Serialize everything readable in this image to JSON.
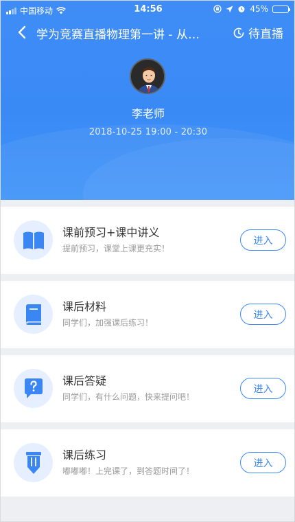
{
  "status_bar": {
    "carrier": "中国移动",
    "time": "14:56",
    "battery": "45%",
    "battery_level": 0.45
  },
  "nav": {
    "title": "学为竞赛直播物理第一讲 - 从…",
    "status_label": "待直播"
  },
  "teacher": {
    "name": "李老师",
    "schedule": "2018-10-25  19:00 - 20:30"
  },
  "colors": {
    "primary": "#3a87f4",
    "header_bg": "#3f8cf6",
    "icon_bg": "#e5efff"
  },
  "sections": [
    {
      "title": "课前预习+课中讲义",
      "subtitle": "提前预习，课堂上课更充实！",
      "button": "进入",
      "icon": "open-book-icon"
    },
    {
      "title": "课后材料",
      "subtitle": "同学们，加强课后练习！",
      "button": "进入",
      "icon": "book-icon"
    },
    {
      "title": "课后答疑",
      "subtitle": "同学们，有什么问题，快来提问吧！",
      "button": "进入",
      "icon": "question-bubble-icon"
    },
    {
      "title": "课后练习",
      "subtitle": "嘟嘟嘟！上完课了，到答题时间了！",
      "button": "进入",
      "icon": "pen-icon"
    }
  ]
}
